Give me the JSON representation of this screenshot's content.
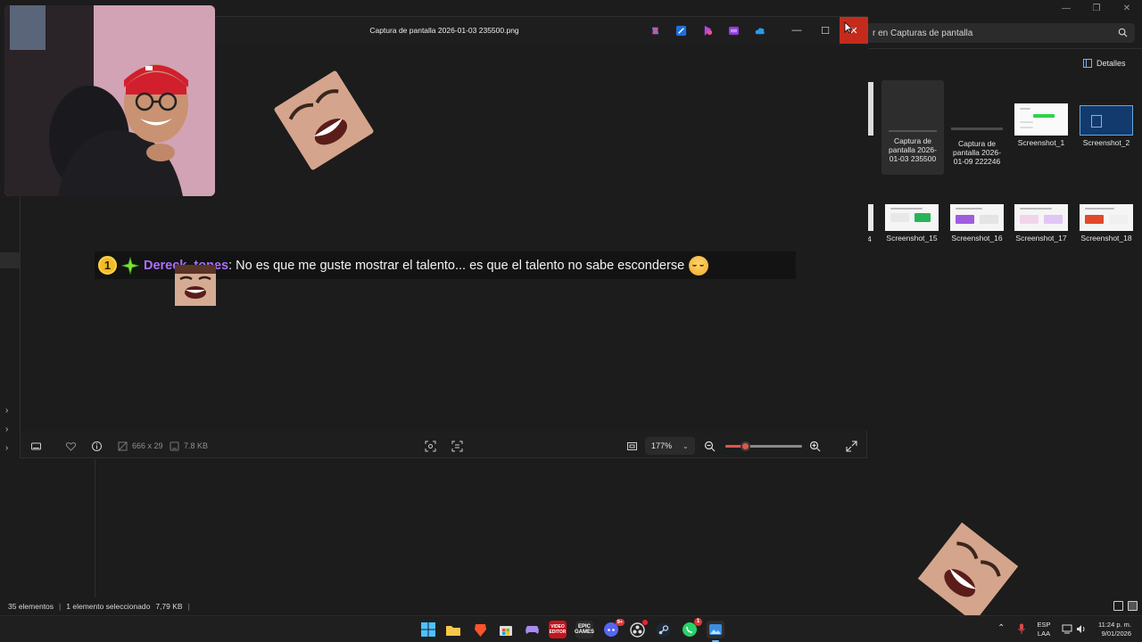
{
  "explorer": {
    "search_placeholder": "r en Capturas de pantalla",
    "details_label": "Detalles",
    "thumbnails_row1": [
      {
        "label": "Captura de pantalla 2026-01-03 235500",
        "selected": true
      },
      {
        "label": "Captura de pantalla 2026-01-09 222246",
        "selected": false
      },
      {
        "label": "Screenshot_1",
        "selected": false
      },
      {
        "label": "Screenshot_2",
        "selected": false
      }
    ],
    "thumbnails_row2": [
      {
        "label": "Screenshot_15"
      },
      {
        "label": "Screenshot_16"
      },
      {
        "label": "Screenshot_17"
      },
      {
        "label": "Screenshot_18"
      }
    ],
    "partial_label": "4",
    "status": {
      "count": "35 elementos",
      "selection": "1 elemento seleccionado",
      "size": "7,79 KB"
    }
  },
  "viewer": {
    "title": "Captura de pantalla 2026-01-03 235500.png",
    "title_icons": [
      "copilot-icon",
      "edit-icon",
      "designer-icon",
      "clipchamp-icon",
      "onedrive-icon"
    ],
    "controls": {
      "minimize": "—",
      "maximize": "☐",
      "close": "✕"
    },
    "chat": {
      "badge": "1",
      "username": "Dereck_tones",
      "message": ": No es que me guste mostrar el talento... es que el talento no sabe esconderse"
    },
    "toolbar": {
      "dimensions": "666 x 29",
      "filesize": "7.8 KB",
      "zoom": "177%",
      "zoom_level": 0.26
    }
  },
  "taskbar": {
    "apps": [
      "start",
      "file-explorer",
      "brave",
      "store",
      "game",
      "video-editor",
      "epic-games",
      "discord",
      "obs",
      "steam",
      "whatsapp",
      "photos"
    ],
    "discord_badge": "9+",
    "whatsapp_badge": "1",
    "lang_top": "ESP",
    "lang_bottom": "LAA",
    "time": "11:24 p. m.",
    "date": "9/01/2026"
  },
  "colors": {
    "accent_close": "#c42b1c",
    "username": "#a970ff",
    "zoom_accent": "#e0564c"
  }
}
